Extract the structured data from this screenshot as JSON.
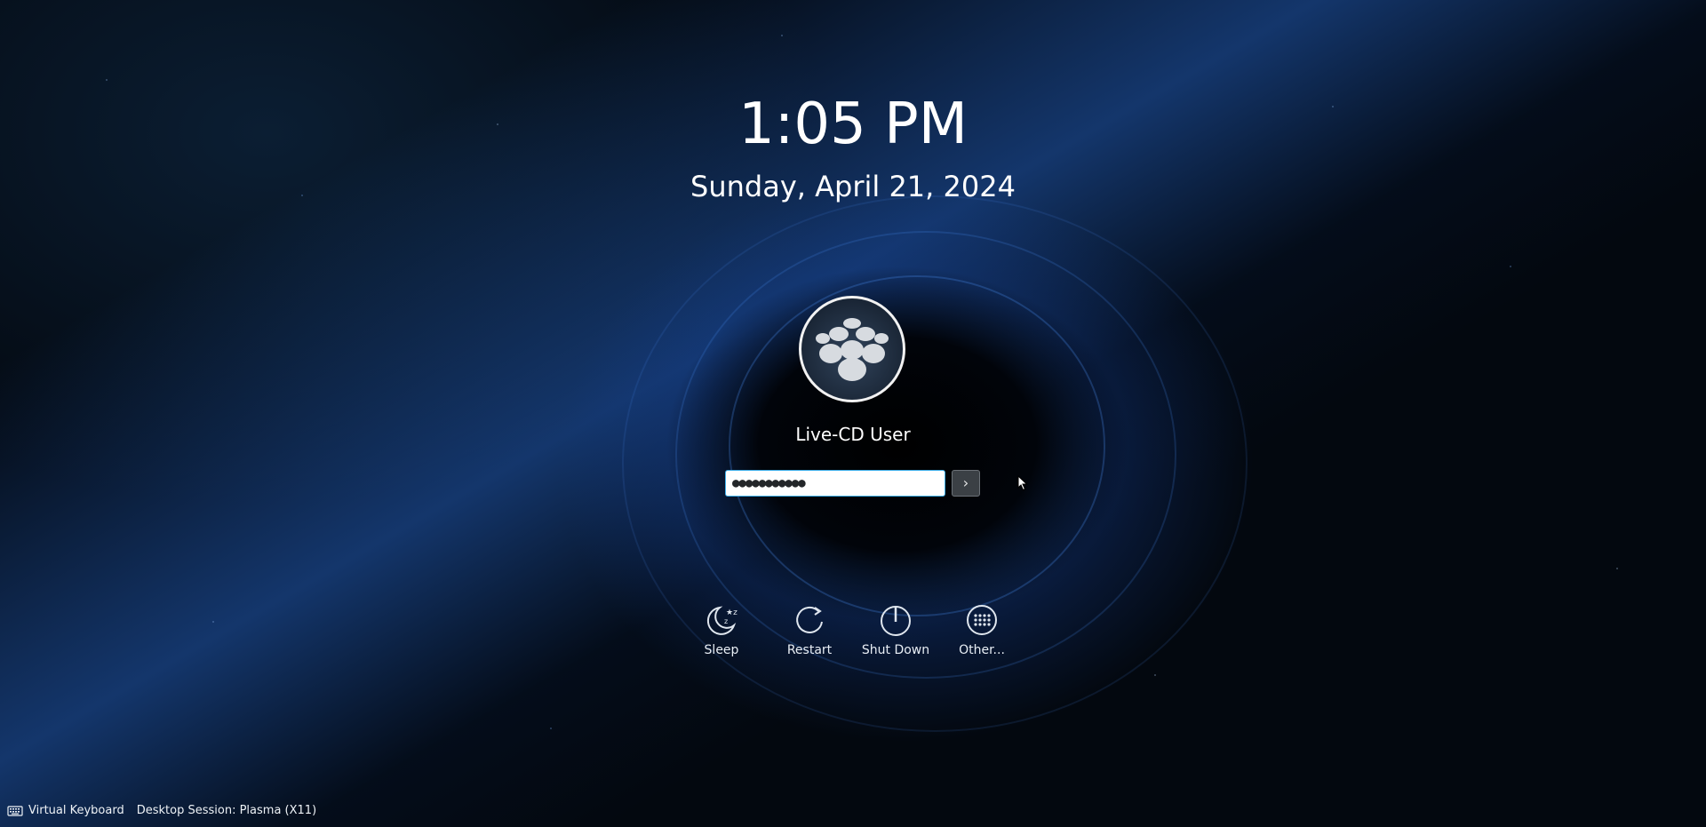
{
  "clock": {
    "time": "1:05 PM",
    "date": "Sunday, April 21, 2024"
  },
  "user": {
    "name": "Live-CD User"
  },
  "login": {
    "password_mask": "●●●●●●●●●●●",
    "submit_glyph": "›"
  },
  "actions": [
    {
      "label": "Sleep",
      "icon": "sleep-icon"
    },
    {
      "label": "Restart",
      "icon": "restart-icon"
    },
    {
      "label": "Shut Down",
      "icon": "power-icon"
    },
    {
      "label": "Other...",
      "icon": "other-icon"
    }
  ],
  "footer": {
    "virtual_keyboard": "Virtual Keyboard",
    "session": "Desktop Session: Plasma (X11)"
  },
  "colors": {
    "accent": "#3daee9",
    "background": "#02060c",
    "swirl": "#3d8ef0"
  }
}
